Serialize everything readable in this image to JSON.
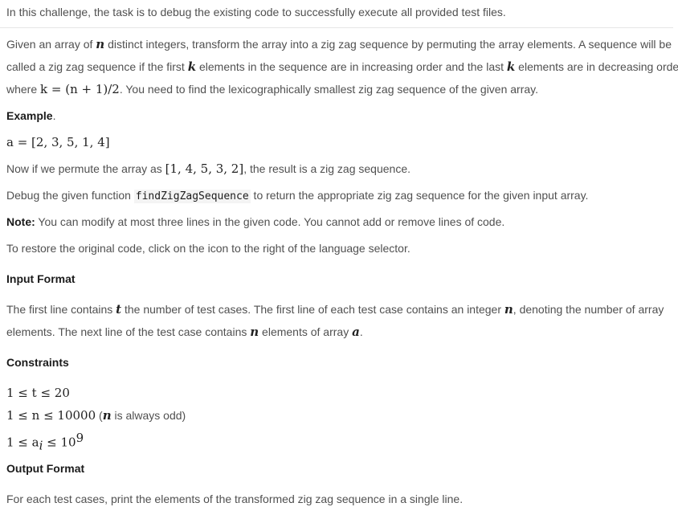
{
  "intro": "In this challenge, the task is to debug the existing code to successfully execute all provided test files.",
  "description": {
    "line1_a": "Given an array of ",
    "var_n": "n",
    "line1_b": " distinct integers, transform the array into a zig zag sequence by permuting the array elements. A sequence will be",
    "line2_a": "called a zig zag sequence if the first ",
    "var_k": "k",
    "line2_b": " elements in the sequence are in increasing order and the last ",
    "line2_c": " elements are in decreasing order,",
    "line3_a": "where ",
    "formula": "k = (n + 1)/2",
    "line3_b": ". You need to find the lexicographically smallest zig zag sequence of the given array."
  },
  "example": {
    "heading": "Example",
    "heading_dot": ".",
    "array_expr": "a = [2, 3, 5, 1, 4]",
    "permute_a": "Now if we permute the array as ",
    "permute_expr": "[1, 4, 5, 3, 2]",
    "permute_b": ", the result is a zig zag sequence."
  },
  "debug": {
    "text_a": "Debug the given function ",
    "function_name": "findZigZagSequence",
    "text_b": " to return the appropriate zig zag sequence for the given input array."
  },
  "note": {
    "label": "Note:",
    "text": " You can modify at most three lines in the given code. You cannot add or remove lines of code."
  },
  "restore": "To restore the original code, click on the icon to the right of the language selector.",
  "input_format": {
    "heading": "Input Format",
    "line1_a": "The first line contains ",
    "var_t": "t",
    "line1_b": " the number of test cases. The first line of each test case contains an integer ",
    "var_n": "n",
    "line1_c": ", denoting the number of array",
    "line2_a": "elements. The next line of the test case contains ",
    "line2_b": " elements of array ",
    "var_a": "a",
    "line2_c": "."
  },
  "constraints": {
    "heading": "Constraints",
    "c1": "1 ≤ t ≤ 20",
    "c2": "1 ≤ n ≤ 10000",
    "c2_note_a": " (",
    "c2_note_var": "n",
    "c2_note_b": " is always odd)",
    "c3_a": "1 ≤ a",
    "c3_sub": "i",
    "c3_b": " ≤ 10",
    "c3_sup": "9"
  },
  "output_format": {
    "heading": "Output Format",
    "text": "For each test cases, print the elements of the transformed zig zag sequence in a single line."
  }
}
